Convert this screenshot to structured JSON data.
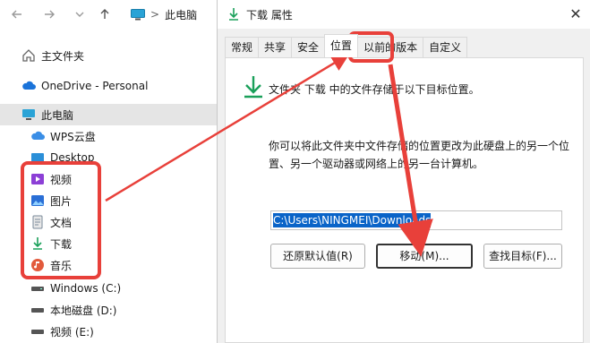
{
  "explorer": {
    "breadcrumb": {
      "separator": ">",
      "current": "此电脑"
    },
    "tree": [
      {
        "label": "主文件夹",
        "icon": "home-icon"
      },
      {
        "label": "OneDrive - Personal",
        "icon": "onedrive-cloud-icon"
      },
      {
        "label": "此电脑",
        "icon": "this-pc-icon",
        "selected": true
      },
      {
        "label": "WPS云盘",
        "icon": "wps-cloud-icon"
      },
      {
        "label": "Desktop",
        "icon": "desktop-folder-icon"
      },
      {
        "label": "视频",
        "icon": "videos-folder-icon"
      },
      {
        "label": "图片",
        "icon": "pictures-folder-icon"
      },
      {
        "label": "文档",
        "icon": "documents-folder-icon"
      },
      {
        "label": "下载",
        "icon": "downloads-folder-icon"
      },
      {
        "label": "音乐",
        "icon": "music-folder-icon"
      },
      {
        "label": "Windows (C:)",
        "icon": "drive-icon"
      },
      {
        "label": "本地磁盘 (D:)",
        "icon": "drive-icon"
      },
      {
        "label": "视频 (E:)",
        "icon": "drive-icon"
      }
    ]
  },
  "dialog": {
    "title": "下载 属性",
    "close_glyph": "✕",
    "tabs": [
      "常规",
      "共享",
      "安全",
      "位置",
      "以前的版本",
      "自定义"
    ],
    "active_tab": "位置",
    "info_line": "文件夹 下载 中的文件存储于以下目标位置。",
    "description": "你可以将此文件夹中文件存储的位置更改为此硬盘上的另一个位置、另一个驱动器或网络上的另一台计算机。",
    "path_value": "C:\\Users\\NINGMEI\\Downloads",
    "buttons": {
      "restore_default": "还原默认值(R)",
      "move": "移动(M)...",
      "find_target": "查找目标(F)..."
    }
  },
  "colors": {
    "annotation_red": "#e8403a",
    "downloads_green": "#1aa05a",
    "selection_blue": "#0a64c8"
  }
}
